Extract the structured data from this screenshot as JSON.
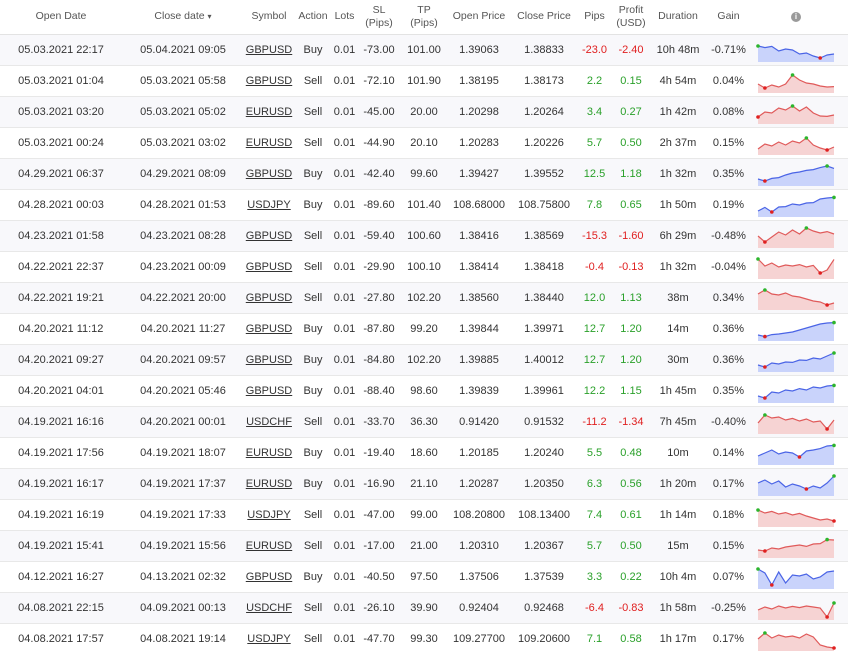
{
  "headers": {
    "open_date": "Open Date",
    "close_date": "Close date",
    "close_date_caret": "▾",
    "symbol": "Symbol",
    "action": "Action",
    "lots": "Lots",
    "sl_1": "SL",
    "sl_2": "(Pips)",
    "tp_1": "TP",
    "tp_2": "(Pips)",
    "open_price": "Open Price",
    "close_price": "Close Price",
    "pips": "Pips",
    "profit_1": "Profit",
    "profit_2": "(USD)",
    "duration": "Duration",
    "gain": "Gain",
    "info_icon": "i"
  },
  "colors": {
    "buy_line": "#4a64e6",
    "buy_fill": "#c9d3fb",
    "sell_line": "#e05a5a",
    "sell_fill": "#f6d3d3",
    "pos": "#2aa02a",
    "neg": "#e02020",
    "dot_green": "#2cb52c",
    "dot_red": "#e02020",
    "comment_icon": "#b5b5b5"
  },
  "icons": {
    "comment": "comment-icon",
    "info": "info-icon",
    "sort": "sort-desc-icon"
  },
  "trades": [
    {
      "open": "05.03.2021 22:17",
      "close": "05.04.2021 09:05",
      "symbol": "GBPUSD",
      "action": "Buy",
      "lots": "0.01",
      "sl": "-73.00",
      "tp": "101.00",
      "open_price": "1.39063",
      "close_price": "1.38833",
      "pips": "-23.0",
      "profit": "-2.40",
      "duration": "10h 48m",
      "gain": "-0.71%",
      "spark": [
        0.7,
        0.62,
        0.68,
        0.45,
        0.55,
        0.5,
        0.3,
        0.35,
        0.2,
        0.1,
        0.25,
        0.3
      ]
    },
    {
      "open": "05.03.2021 01:04",
      "close": "05.03.2021 05:58",
      "symbol": "GBPUSD",
      "action": "Sell",
      "lots": "0.01",
      "sl": "-72.10",
      "tp": "101.90",
      "open_price": "1.38195",
      "close_price": "1.38173",
      "pips": "2.2",
      "profit": "0.15",
      "duration": "4h 54m",
      "gain": "0.04%",
      "spark": [
        0.35,
        0.15,
        0.3,
        0.2,
        0.35,
        0.8,
        0.55,
        0.4,
        0.35,
        0.25,
        0.2,
        0.22
      ]
    },
    {
      "open": "05.03.2021 03:20",
      "close": "05.03.2021 05:02",
      "symbol": "EURUSD",
      "action": "Sell",
      "lots": "0.01",
      "sl": "-45.00",
      "tp": "20.00",
      "open_price": "1.20298",
      "close_price": "1.20264",
      "pips": "3.4",
      "profit": "0.27",
      "duration": "1h 42m",
      "gain": "0.08%",
      "spark": [
        0.25,
        0.5,
        0.45,
        0.7,
        0.6,
        0.8,
        0.55,
        0.75,
        0.45,
        0.3,
        0.28,
        0.35
      ]
    },
    {
      "open": "05.03.2021 00:24",
      "close": "05.03.2021 03:02",
      "symbol": "EURUSD",
      "action": "Sell",
      "lots": "0.01",
      "sl": "-44.90",
      "tp": "20.10",
      "open_price": "1.20283",
      "close_price": "1.20226",
      "pips": "5.7",
      "profit": "0.50",
      "duration": "2h 37m",
      "gain": "0.15%",
      "spark": [
        0.2,
        0.45,
        0.35,
        0.55,
        0.4,
        0.6,
        0.5,
        0.75,
        0.4,
        0.25,
        0.15,
        0.3
      ]
    },
    {
      "open": "04.29.2021 06:37",
      "close": "04.29.2021 08:09",
      "symbol": "GBPUSD",
      "action": "Buy",
      "lots": "0.01",
      "sl": "-42.40",
      "tp": "99.60",
      "open_price": "1.39427",
      "close_price": "1.39552",
      "pips": "12.5",
      "profit": "1.18",
      "duration": "1h 32m",
      "gain": "0.35%",
      "spark": [
        0.25,
        0.15,
        0.28,
        0.32,
        0.45,
        0.55,
        0.6,
        0.68,
        0.72,
        0.82,
        0.9,
        0.78
      ]
    },
    {
      "open": "04.28.2021 00:03",
      "close": "04.28.2021 01:53",
      "symbol": "USDJPY",
      "action": "Buy",
      "lots": "0.01",
      "sl": "-89.60",
      "tp": "101.40",
      "open_price": "108.68000",
      "close_price": "108.75800",
      "pips": "7.8",
      "profit": "0.65",
      "duration": "1h 50m",
      "gain": "0.19%",
      "spark": [
        0.2,
        0.38,
        0.15,
        0.4,
        0.42,
        0.55,
        0.5,
        0.6,
        0.62,
        0.8,
        0.85,
        0.88
      ]
    },
    {
      "open": "04.23.2021 01:58",
      "close": "04.23.2021 08:28",
      "symbol": "GBPUSD",
      "action": "Sell",
      "lots": "0.01",
      "sl": "-59.40",
      "tp": "100.60",
      "open_price": "1.38416",
      "close_price": "1.38569",
      "pips": "-15.3",
      "profit": "-1.60",
      "duration": "6h 29m",
      "gain": "-0.48%",
      "spark": [
        0.5,
        0.2,
        0.45,
        0.7,
        0.55,
        0.8,
        0.6,
        0.9,
        0.75,
        0.65,
        0.72,
        0.6
      ]
    },
    {
      "open": "04.22.2021 22:37",
      "close": "04.23.2021 00:09",
      "symbol": "GBPUSD",
      "action": "Sell",
      "lots": "0.01",
      "sl": "-29.90",
      "tp": "100.10",
      "open_price": "1.38414",
      "close_price": "1.38418",
      "pips": "-0.4",
      "profit": "-0.13",
      "duration": "1h 32m",
      "gain": "-0.04%",
      "spark": [
        0.9,
        0.55,
        0.7,
        0.5,
        0.6,
        0.55,
        0.62,
        0.5,
        0.58,
        0.2,
        0.35,
        0.88
      ]
    },
    {
      "open": "04.22.2021 19:21",
      "close": "04.22.2021 20:00",
      "symbol": "GBPUSD",
      "action": "Sell",
      "lots": "0.01",
      "sl": "-27.80",
      "tp": "102.20",
      "open_price": "1.38560",
      "close_price": "1.38440",
      "pips": "12.0",
      "profit": "1.13",
      "duration": "38m",
      "gain": "0.34%",
      "spark": [
        0.7,
        0.9,
        0.7,
        0.65,
        0.75,
        0.6,
        0.55,
        0.45,
        0.35,
        0.3,
        0.15,
        0.25
      ]
    },
    {
      "open": "04.20.2021 11:12",
      "close": "04.20.2021 11:27",
      "symbol": "GBPUSD",
      "action": "Buy",
      "lots": "0.01",
      "sl": "-87.80",
      "tp": "99.20",
      "open_price": "1.39844",
      "close_price": "1.39971",
      "pips": "12.7",
      "profit": "1.20",
      "duration": "14m",
      "gain": "0.36%",
      "spark": [
        0.2,
        0.12,
        0.22,
        0.25,
        0.3,
        0.35,
        0.45,
        0.55,
        0.65,
        0.75,
        0.8,
        0.82
      ]
    },
    {
      "open": "04.20.2021 09:27",
      "close": "04.20.2021 09:57",
      "symbol": "GBPUSD",
      "action": "Buy",
      "lots": "0.01",
      "sl": "-84.80",
      "tp": "102.20",
      "open_price": "1.39885",
      "close_price": "1.40012",
      "pips": "12.7",
      "profit": "1.20",
      "duration": "30m",
      "gain": "0.36%",
      "spark": [
        0.25,
        0.15,
        0.35,
        0.3,
        0.4,
        0.38,
        0.5,
        0.48,
        0.6,
        0.55,
        0.7,
        0.85
      ]
    },
    {
      "open": "04.20.2021 04:01",
      "close": "04.20.2021 05:46",
      "symbol": "GBPUSD",
      "action": "Buy",
      "lots": "0.01",
      "sl": "-88.40",
      "tp": "98.60",
      "open_price": "1.39839",
      "close_price": "1.39961",
      "pips": "12.2",
      "profit": "1.15",
      "duration": "1h 45m",
      "gain": "0.35%",
      "spark": [
        0.25,
        0.15,
        0.45,
        0.4,
        0.55,
        0.5,
        0.62,
        0.55,
        0.7,
        0.65,
        0.75,
        0.78
      ]
    },
    {
      "open": "04.19.2021 16:16",
      "close": "04.20.2021 00:01",
      "symbol": "USDCHF",
      "action": "Sell",
      "lots": "0.01",
      "sl": "-33.70",
      "tp": "36.30",
      "open_price": "0.91420",
      "close_price": "0.91532",
      "pips": "-11.2",
      "profit": "-1.34",
      "duration": "7h 45m",
      "gain": "-0.40%",
      "spark": [
        0.45,
        0.85,
        0.7,
        0.75,
        0.6,
        0.68,
        0.55,
        0.65,
        0.5,
        0.55,
        0.15,
        0.6
      ]
    },
    {
      "open": "04.19.2021 17:56",
      "close": "04.19.2021 18:07",
      "symbol": "EURUSD",
      "action": "Buy",
      "lots": "0.01",
      "sl": "-19.40",
      "tp": "18.60",
      "open_price": "1.20185",
      "close_price": "1.20240",
      "pips": "5.5",
      "profit": "0.48",
      "duration": "10m",
      "gain": "0.14%",
      "spark": [
        0.35,
        0.5,
        0.65,
        0.45,
        0.55,
        0.5,
        0.3,
        0.6,
        0.65,
        0.72,
        0.85,
        0.88
      ]
    },
    {
      "open": "04.19.2021 16:17",
      "close": "04.19.2021 17:37",
      "symbol": "EURUSD",
      "action": "Buy",
      "lots": "0.01",
      "sl": "-16.90",
      "tp": "21.10",
      "open_price": "1.20287",
      "close_price": "1.20350",
      "pips": "6.3",
      "profit": "0.56",
      "duration": "1h 20m",
      "gain": "0.17%",
      "spark": [
        0.55,
        0.7,
        0.5,
        0.65,
        0.35,
        0.5,
        0.4,
        0.25,
        0.4,
        0.3,
        0.55,
        0.9
      ]
    },
    {
      "open": "04.19.2021 16:19",
      "close": "04.19.2021 17:33",
      "symbol": "USDJPY",
      "action": "Sell",
      "lots": "0.01",
      "sl": "-47.00",
      "tp": "99.00",
      "open_price": "108.20800",
      "close_price": "108.13400",
      "pips": "7.4",
      "profit": "0.61",
      "duration": "1h 14m",
      "gain": "0.18%",
      "spark": [
        0.75,
        0.6,
        0.68,
        0.55,
        0.62,
        0.5,
        0.58,
        0.45,
        0.35,
        0.25,
        0.3,
        0.2
      ]
    },
    {
      "open": "04.19.2021 15:41",
      "close": "04.19.2021 15:56",
      "symbol": "EURUSD",
      "action": "Sell",
      "lots": "0.01",
      "sl": "-17.00",
      "tp": "21.00",
      "open_price": "1.20310",
      "close_price": "1.20367",
      "pips": "5.7",
      "profit": "0.50",
      "duration": "15m",
      "gain": "0.15%",
      "spark": [
        0.3,
        0.25,
        0.4,
        0.35,
        0.45,
        0.5,
        0.55,
        0.48,
        0.6,
        0.62,
        0.82,
        0.8
      ]
    },
    {
      "open": "04.12.2021 16:27",
      "close": "04.13.2021 02:32",
      "symbol": "GBPUSD",
      "action": "Buy",
      "lots": "0.01",
      "sl": "-40.50",
      "tp": "97.50",
      "open_price": "1.37506",
      "close_price": "1.37539",
      "pips": "3.3",
      "profit": "0.22",
      "duration": "10h 4m",
      "gain": "0.07%",
      "spark": [
        0.9,
        0.7,
        0.1,
        0.75,
        0.2,
        0.6,
        0.55,
        0.65,
        0.4,
        0.5,
        0.75,
        0.8
      ]
    },
    {
      "open": "04.08.2021 22:15",
      "close": "04.09.2021 00:13",
      "symbol": "USDCHF",
      "action": "Sell",
      "lots": "0.01",
      "sl": "-26.10",
      "tp": "39.90",
      "open_price": "0.92404",
      "close_price": "0.92468",
      "pips": "-6.4",
      "profit": "-0.83",
      "duration": "1h 58m",
      "gain": "-0.25%",
      "spark": [
        0.4,
        0.55,
        0.45,
        0.6,
        0.5,
        0.58,
        0.52,
        0.6,
        0.55,
        0.5,
        0.05,
        0.75
      ]
    },
    {
      "open": "04.08.2021 17:57",
      "close": "04.08.2021 19:14",
      "symbol": "USDJPY",
      "action": "Sell",
      "lots": "0.01",
      "sl": "-47.70",
      "tp": "99.30",
      "open_price": "109.27700",
      "close_price": "109.20600",
      "pips": "7.1",
      "profit": "0.58",
      "duration": "1h 17m",
      "gain": "0.17%",
      "spark": [
        0.5,
        0.8,
        0.55,
        0.7,
        0.6,
        0.65,
        0.55,
        0.75,
        0.6,
        0.2,
        0.1,
        0.05
      ]
    }
  ]
}
